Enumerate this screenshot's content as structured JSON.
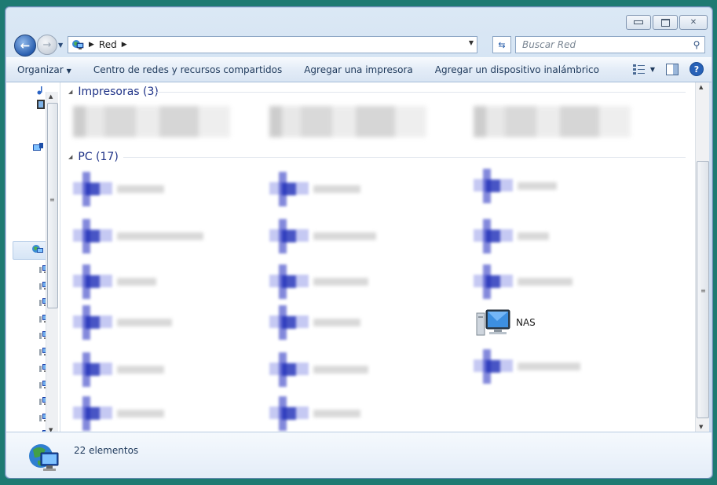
{
  "window": {
    "caption_buttons": {
      "minimize": "▭",
      "maximize": "□",
      "close": "✕"
    }
  },
  "address_bar": {
    "location": "Red",
    "search_placeholder": "Buscar Red"
  },
  "toolbar": {
    "organize": "Organizar",
    "network_center": "Centro de redes y recursos compartidos",
    "add_printer": "Agregar una impresora",
    "add_wireless": "Agregar un dispositivo inalámbrico",
    "help": "?"
  },
  "groups": {
    "printers": {
      "header": "Impresoras (3)"
    },
    "pcs": {
      "header": "PC (17)"
    }
  },
  "nas_item": {
    "label": "NAS"
  },
  "status": {
    "item_count": "22 elementos"
  },
  "colors": {
    "accent": "#1e3287",
    "desktop": "#1e7a72"
  }
}
